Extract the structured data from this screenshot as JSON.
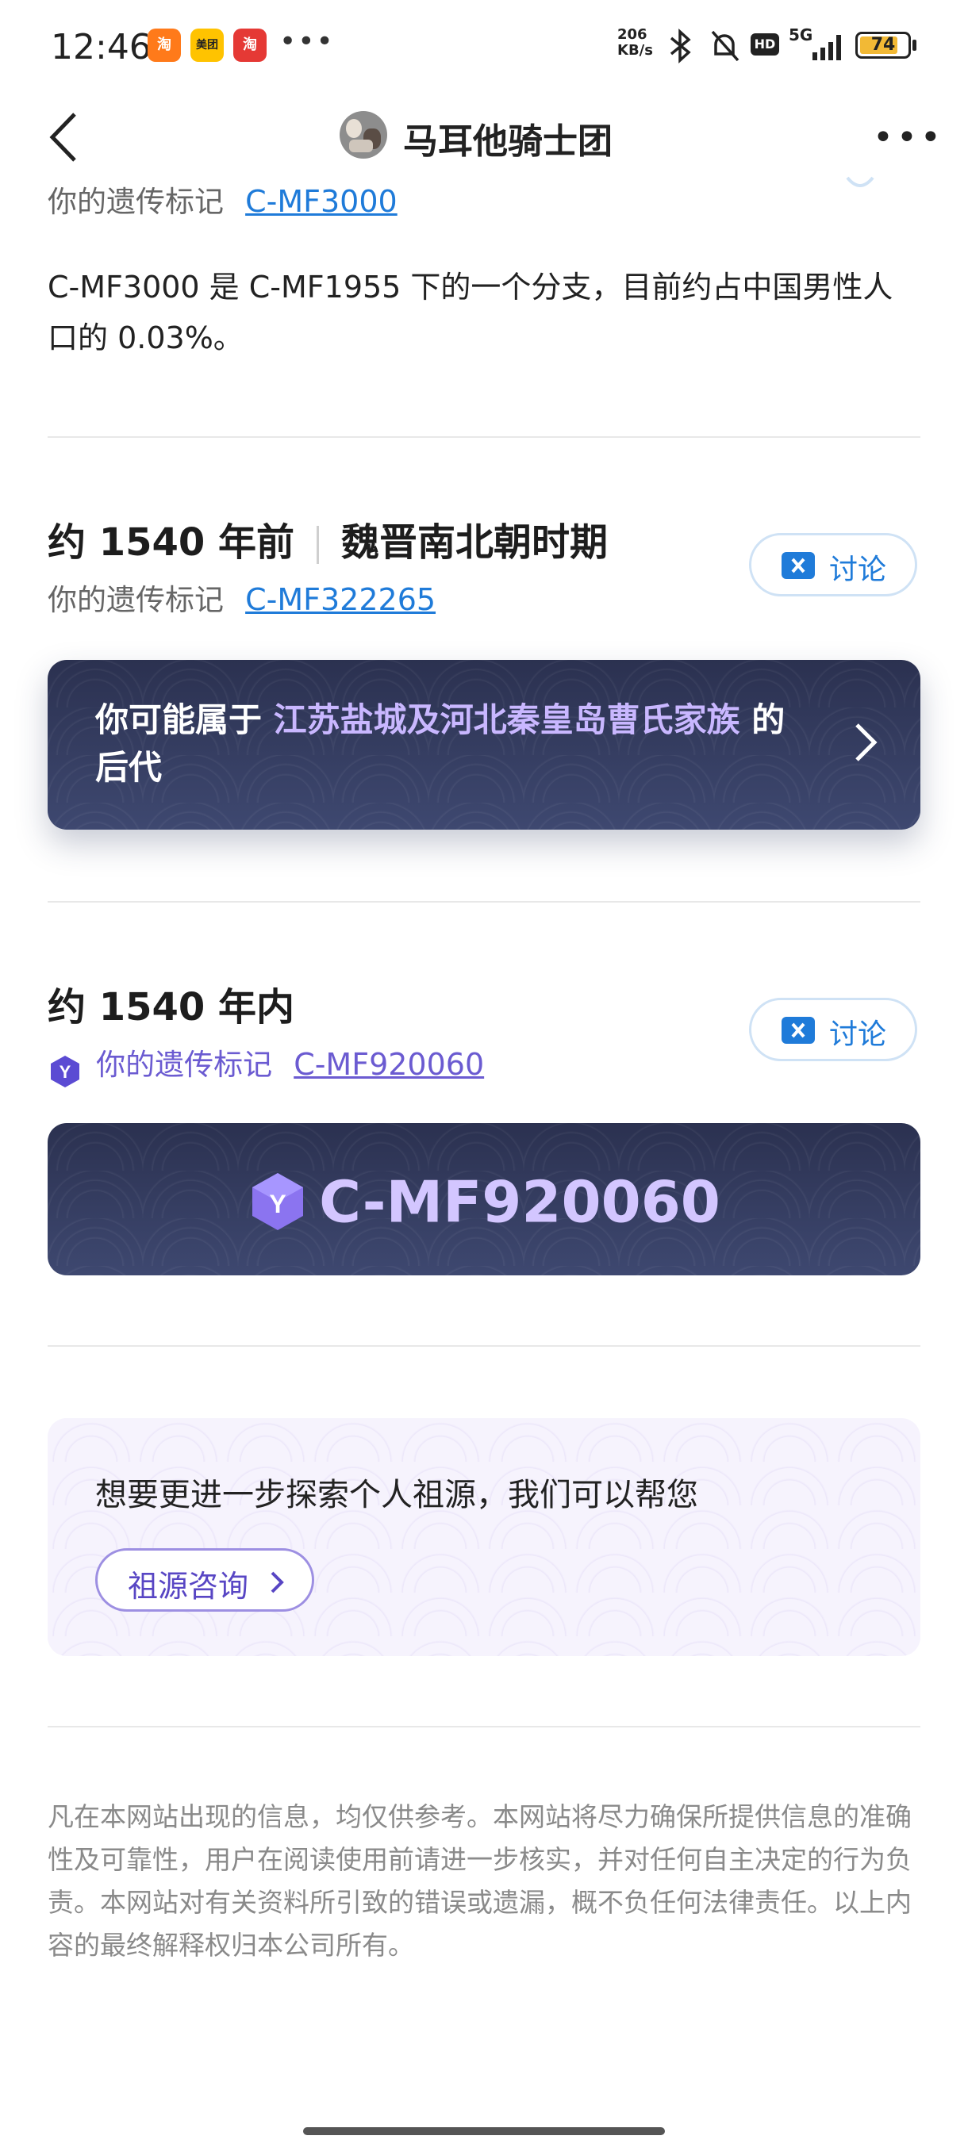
{
  "status_bar": {
    "time": "12:46",
    "notification_icons": [
      {
        "name": "taobao-app-icon",
        "label": "淘",
        "color": "#ff7a1a"
      },
      {
        "name": "meituan-app-icon",
        "label": "美团",
        "color": "#ffc300"
      },
      {
        "name": "taobao-618-app-icon",
        "label": "淘",
        "color": "#e53935"
      }
    ],
    "more_dots": "•••",
    "network_speed": "206 KB/s",
    "network_type": "5G",
    "hd_label": "HD",
    "battery_level": "74"
  },
  "nav": {
    "title": "马耳他骑士团",
    "back_icon": "chevron-left-icon",
    "more_icon": "more-dots-icon",
    "more_label": "•••"
  },
  "section1": {
    "marker_label": "你的遗传标记",
    "marker_link": "C-MF3000",
    "description": "C-MF3000 是 C-MF1955 下的一个分支，目前约占中国男性人口的 0.03%。"
  },
  "section2": {
    "time_label": "约 1540 年前",
    "period_label": "魏晋南北朝时期",
    "marker_label": "你的遗传标记",
    "marker_link": "C-MF322265",
    "discuss_label": "讨论",
    "lineage_prefix": "你可能属于",
    "lineage_highlight": "江苏盐城及河北秦皇岛曹氏家族",
    "lineage_suffix": "的后代"
  },
  "section3": {
    "time_label": "约 1540 年内",
    "marker_label": "你的遗传标记",
    "marker_link": "C-MF920060",
    "badge_letter": "Y",
    "discuss_label": "讨论",
    "card_marker": "C-MF920060"
  },
  "explore": {
    "question": "想要更进一步探索个人祖源，我们可以帮您",
    "button_label": "祖源咨询"
  },
  "disclaimer": "凡在本网站出现的信息，均仅供参考。本网站将尽力确保所提供信息的准确性及可靠性，用户在阅读使用前请进一步核实，并对任何自主决定的行为负责。本网站对有关资料所引致的错误或遗漏，概不负任何法律责任。以上内容的最终解释权归本公司所有。",
  "colors": {
    "link_blue": "#1f7bd9",
    "purple_accent": "#6b5bd1",
    "card_dark": "#323a5c",
    "highlight_lilac": "#c9b7ff"
  }
}
